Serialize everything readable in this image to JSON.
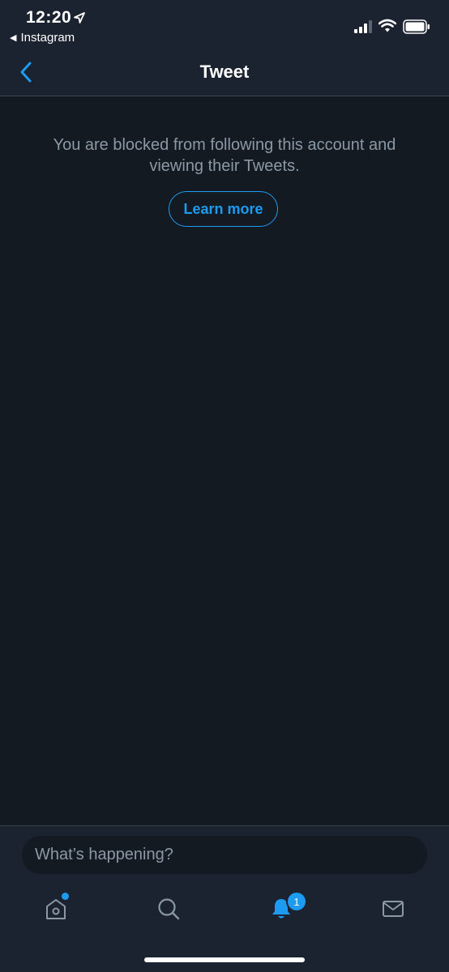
{
  "status_bar": {
    "time": "12:20",
    "back_app_label": "Instagram",
    "back_app_arrow": "◀"
  },
  "nav": {
    "title": "Tweet",
    "back_icon": "chevron-left-icon"
  },
  "main": {
    "blocked_message": "You are blocked from following this account and viewing their Tweets.",
    "learn_more_label": "Learn more"
  },
  "compose": {
    "placeholder": "What’s happening?"
  },
  "tab_bar": {
    "tabs": [
      {
        "name": "home",
        "icon": "home-icon",
        "has_dot": true
      },
      {
        "name": "search",
        "icon": "search-icon"
      },
      {
        "name": "notifications",
        "icon": "bell-icon",
        "badge": "1",
        "active": true
      },
      {
        "name": "messages",
        "icon": "mail-icon"
      }
    ]
  },
  "colors": {
    "background": "#141a22",
    "bar_background": "#1b2330",
    "accent": "#1d9bf0",
    "muted_text": "#8b98a5"
  }
}
